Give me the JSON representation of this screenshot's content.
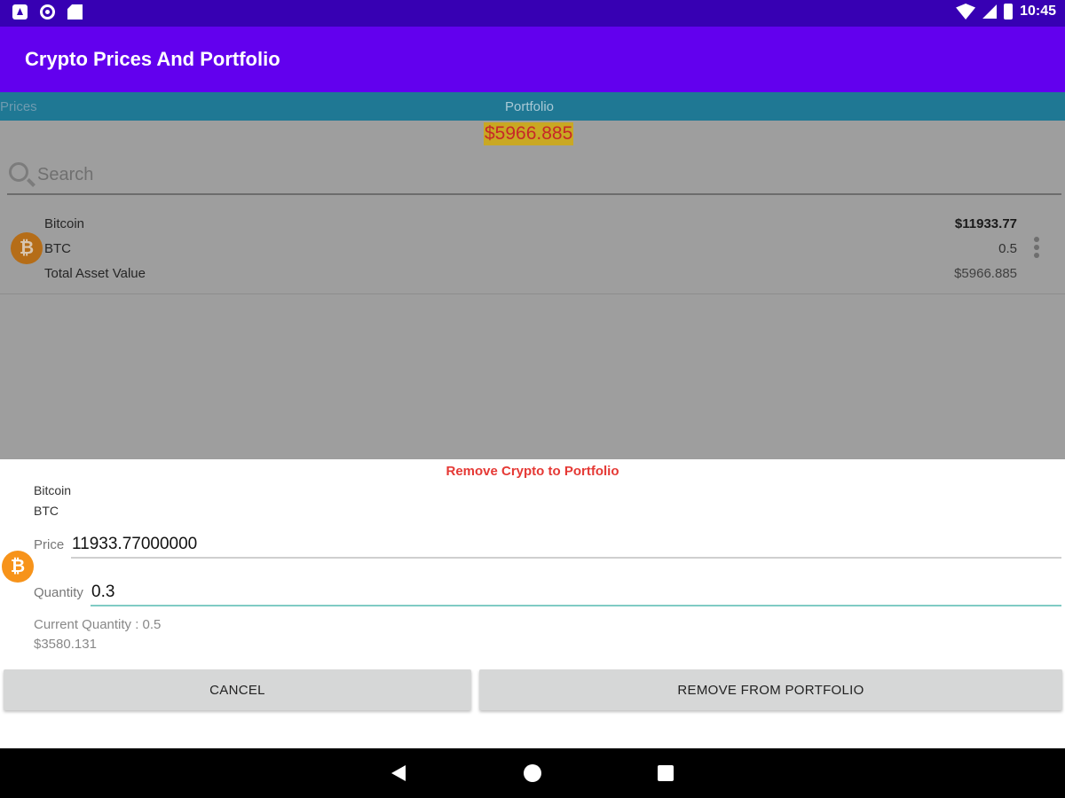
{
  "status_bar": {
    "time": "10:45",
    "left_icons": [
      "notification-a-icon",
      "sync-icon",
      "sd-card-icon"
    ],
    "right_icons": [
      "wifi-icon",
      "cell-signal-icon",
      "battery-icon"
    ]
  },
  "app_bar": {
    "title": "Crypto Prices And Portfolio"
  },
  "tabs": [
    {
      "label": "Prices"
    },
    {
      "label": "Portfolio"
    }
  ],
  "portfolio": {
    "total": "$5966.885",
    "search_placeholder": "Search",
    "assets": [
      {
        "icon": "bitcoin-icon",
        "name": "Bitcoin",
        "symbol": "BTC",
        "total_label": "Total Asset Value",
        "price": "$11933.77",
        "quantity": "0.5",
        "value": "$5966.885"
      }
    ]
  },
  "dialog": {
    "title": "Remove Crypto to Portfolio",
    "coin_name": "Bitcoin",
    "coin_symbol": "BTC",
    "coin_glyph": "₿",
    "price_label": "Price",
    "price_value": "11933.77000000",
    "quantity_label": "Quantity",
    "quantity_value": "0.3",
    "current_quantity": "Current Quantity : 0.5",
    "computed_value": "$3580.131",
    "cancel_label": "CANCEL",
    "remove_label": "REMOVE FROM PORTFOLIO"
  },
  "colors": {
    "status_bar": "#3700b3",
    "app_bar": "#6200ee",
    "tab_bar": "#1f7894",
    "bitcoin": "#f7931a",
    "dialog_title": "#e53935",
    "input_focus": "#80cbc4"
  }
}
